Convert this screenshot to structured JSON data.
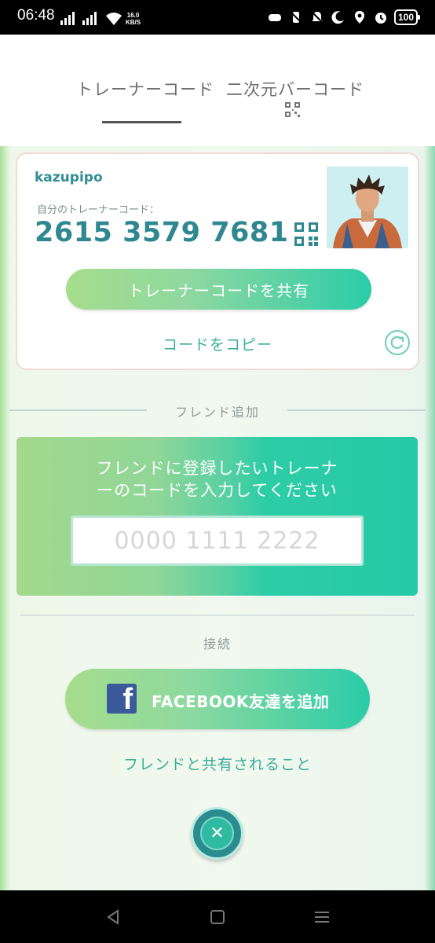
{
  "status_bar": {
    "time": "06:48",
    "net_speed_value": "16.0",
    "net_speed_unit": "KB/S",
    "battery": "100"
  },
  "tabs": {
    "trainer_code": "トレーナーコード",
    "qr_code": "二次元バーコード"
  },
  "card": {
    "username": "kazupipo",
    "code_label": "自分のトレーナーコード：",
    "trainer_code": "2615 3579 7681",
    "share_button": "トレーナーコードを共有",
    "copy_link": "コードをコピー"
  },
  "add_friend": {
    "section_title": "フレンド追加",
    "prompt_line1": "フレンドに登録したいトレーナ",
    "prompt_line2": "ーのコードを入力してください",
    "input_placeholder": "0000 1111 2222",
    "input_value": ""
  },
  "connect": {
    "section_title": "接続",
    "facebook_button": "FACEBOOK友達を追加",
    "share_info_link": "フレンドと共有されること"
  },
  "colors": {
    "accent_teal": "#2f8890",
    "link_green": "#3aae96",
    "facebook_blue": "#3b5a9a"
  },
  "icons": {
    "qr": "qr-code-icon",
    "refresh": "refresh-icon",
    "close": "close-icon",
    "facebook": "facebook-icon"
  }
}
